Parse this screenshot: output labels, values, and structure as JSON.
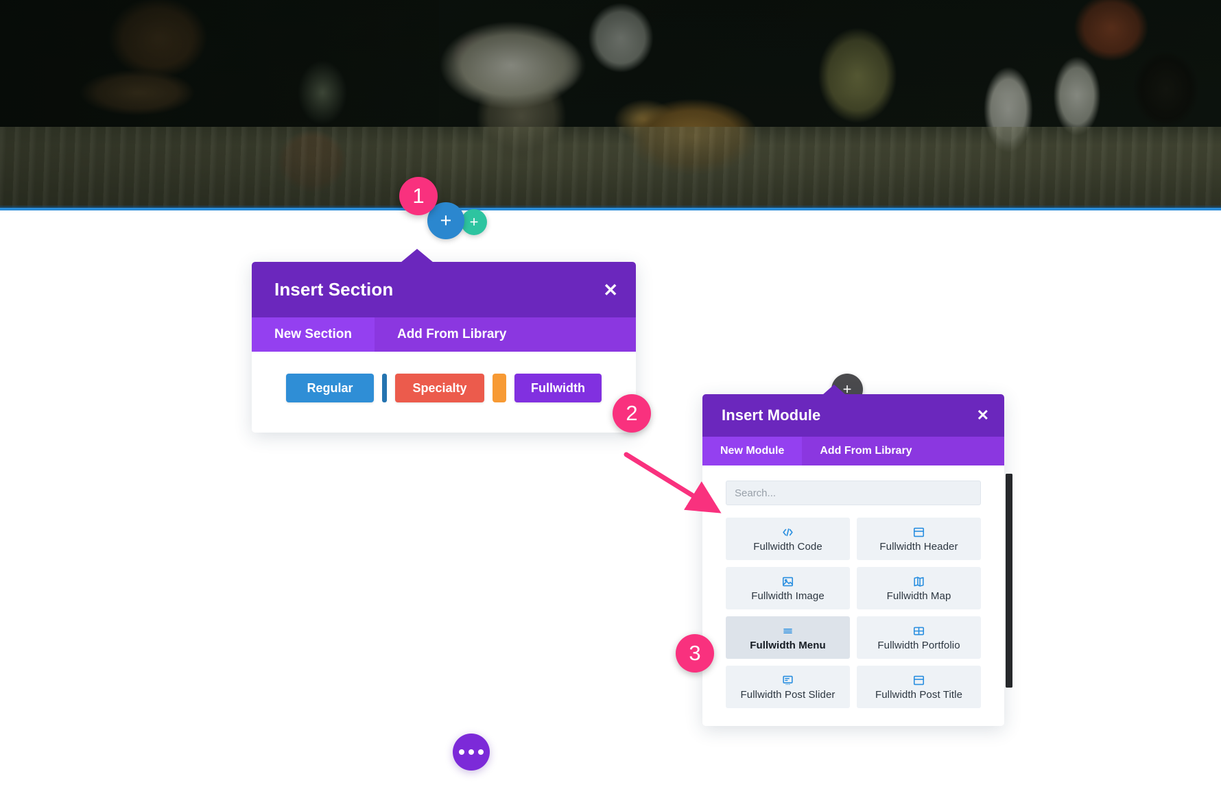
{
  "hero": {
    "alt_description": "Dark photo of potted plants and succulents on a cloth-covered table",
    "divider_color": "#2a8cd8"
  },
  "hover_buttons": {
    "add_section": {
      "label": "+",
      "icon": "plus-icon",
      "color": "#2b87cf"
    },
    "add_row": {
      "label": "+",
      "icon": "plus-icon",
      "color": "#2ec4a0"
    }
  },
  "step_badges": [
    {
      "number": "1",
      "color": "#f9317e"
    },
    {
      "number": "2",
      "color": "#f9317e"
    },
    {
      "number": "3",
      "color": "#f9317e"
    }
  ],
  "insert_section": {
    "title": "Insert Section",
    "close_label": "✕",
    "tabs": [
      {
        "label": "New Section",
        "active": true
      },
      {
        "label": "Add From Library",
        "active": false
      }
    ],
    "layout_buttons": [
      {
        "label": "Regular",
        "color": "#2f8ed6"
      },
      {
        "label": "Specialty",
        "color": "#ec5b4c"
      },
      {
        "label": "Fullwidth",
        "color": "#8130e0"
      }
    ],
    "header_color": "#6b27bd",
    "tabbar_color": "#8b37e0",
    "active_tab_color": "#9440f0"
  },
  "insert_module": {
    "title": "Insert Module",
    "close_label": "✕",
    "add_button_label": "+",
    "tabs": [
      {
        "label": "New Module",
        "active": true
      },
      {
        "label": "Add From Library",
        "active": false
      }
    ],
    "search": {
      "value": "",
      "placeholder": "Search..."
    },
    "modules": [
      {
        "label": "Fullwidth Code",
        "icon": "code-icon",
        "selected": false
      },
      {
        "label": "Fullwidth Header",
        "icon": "header-icon",
        "selected": false
      },
      {
        "label": "Fullwidth Image",
        "icon": "image-icon",
        "selected": false
      },
      {
        "label": "Fullwidth Map",
        "icon": "map-icon",
        "selected": false
      },
      {
        "label": "Fullwidth Menu",
        "icon": "menu-icon",
        "selected": true
      },
      {
        "label": "Fullwidth Portfolio",
        "icon": "grid-icon",
        "selected": false
      },
      {
        "label": "Fullwidth Post Slider",
        "icon": "post-slider-icon",
        "selected": false
      },
      {
        "label": "Fullwidth Post Title",
        "icon": "post-title-icon",
        "selected": false
      }
    ],
    "icon_color": "#2a8fe0",
    "card_color": "#eef2f6",
    "selected_card_color": "#dde3ea"
  },
  "bottom_toolbar": {
    "dots_button": {
      "icon": "ellipsis-icon",
      "color": "#7c2ad8"
    }
  },
  "annotation_arrow": {
    "color": "#f9317e"
  }
}
